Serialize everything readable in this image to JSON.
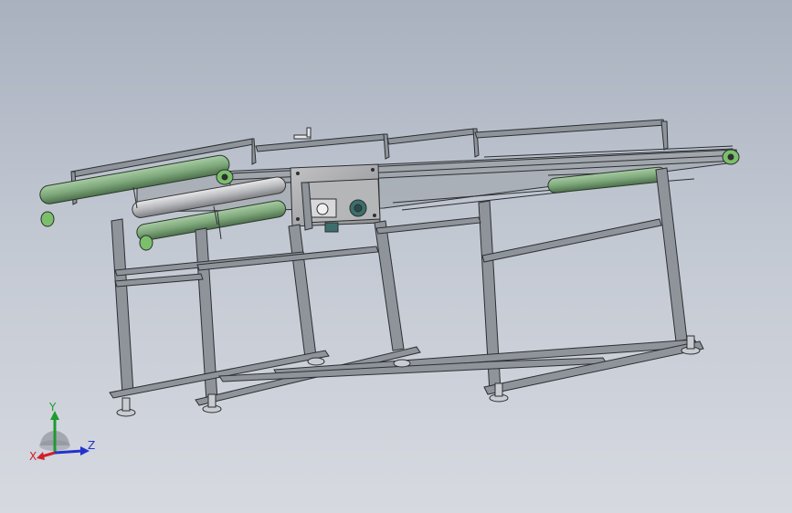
{
  "viewport": {
    "background_top": "#a9b1bf",
    "background_bottom": "#d6d9e0",
    "frame_color": "#8e949a",
    "frame_edge_color": "#2c2f33",
    "roller_color": "#7fa97c",
    "roller_edge_color": "#2a3a2a",
    "plate_color": "#a7a7a9",
    "motor_color": "#3c6e6c"
  },
  "triad": {
    "x_label": "X",
    "y_label": "Y",
    "z_label": "Z",
    "x_color": "#d0202a",
    "y_color": "#1f9a2f",
    "z_color": "#2233cc"
  }
}
